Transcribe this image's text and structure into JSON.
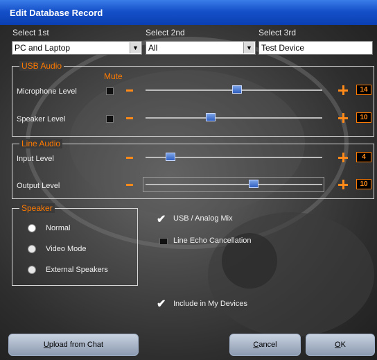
{
  "window": {
    "title": "Edit Database Record"
  },
  "selects": {
    "first": {
      "label": "Select 1st",
      "value": "PC and Laptop"
    },
    "second": {
      "label": "Select 2nd",
      "value": "All"
    },
    "third": {
      "label": "Select 3rd",
      "value": "Test Device"
    }
  },
  "usb_audio": {
    "title": "USB Audio",
    "mute_header": "Mute",
    "microphone": {
      "label": "Microphone Level",
      "value": "14",
      "muted": false,
      "level": 0.52
    },
    "speaker": {
      "label": "Speaker Level",
      "value": "10",
      "muted": false,
      "level": 0.36
    }
  },
  "line_audio": {
    "title": "Line Audio",
    "input": {
      "label": "Input Level",
      "value": "4",
      "level": 0.12
    },
    "output": {
      "label": "Output Level",
      "value": "10",
      "level": 0.62
    }
  },
  "speaker_group": {
    "title": "Speaker",
    "options": [
      "Normal",
      "Video Mode",
      "External Speakers"
    ],
    "selected": "Normal"
  },
  "options": {
    "usb_analog_mix": {
      "label": "USB / Analog Mix",
      "checked": true
    },
    "line_echo": {
      "label": "Line Echo Cancellation",
      "checked": false
    },
    "include_devices": {
      "label": "Include in My Devices",
      "checked": true
    }
  },
  "buttons": {
    "upload": {
      "pre": "",
      "u": "U",
      "post": "pload from Chat"
    },
    "cancel": {
      "pre": "",
      "u": "C",
      "post": "ancel"
    },
    "ok": {
      "pre": "",
      "u": "O",
      "post": "K"
    }
  },
  "icons": {
    "dropdown": "dropdown-arrow-icon",
    "check": "checkmark-icon",
    "plus": "plus-icon",
    "minus": "minus-icon"
  }
}
